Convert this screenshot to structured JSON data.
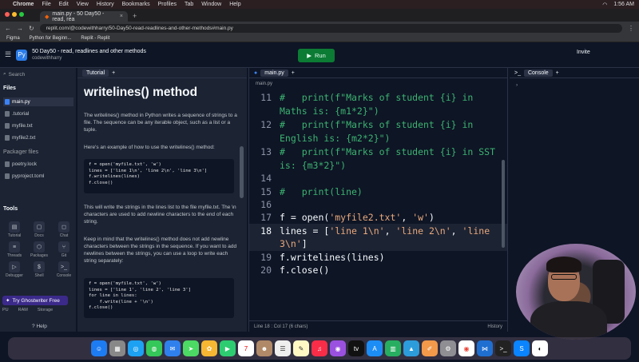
{
  "os_menu": {
    "apple": "",
    "app": "Chrome",
    "items": [
      "File",
      "Edit",
      "View",
      "History",
      "Bookmarks",
      "Profiles",
      "Tab",
      "Window",
      "Help"
    ],
    "clock": "1:56 AM"
  },
  "browser": {
    "tab_title": "main.py - 50 Day50 - read, rea",
    "url": "replit.com/@codewithharry/50-Day50-read-readlines-and-other-methods#main.py",
    "bookmarks": [
      "Figma",
      "Python for Beginn...",
      "Replit - Replit"
    ]
  },
  "repl": {
    "title": "50 Day50 - read, readlines and other methods",
    "owner": "codewithharry",
    "run_label": "Run",
    "invite_label": "Invite"
  },
  "sidebar": {
    "search_placeholder": "Search",
    "files_header": "Files",
    "files": [
      "main.py",
      ".tutorial",
      "myfile.txt",
      "myfile2.txt"
    ],
    "packager_header": "Packager files",
    "packager_files": [
      "poetry.lock",
      "pyproject.toml"
    ],
    "tools_header": "Tools",
    "tools": [
      "Tutorial",
      "Docs",
      "Chat",
      "Threads",
      "Packages",
      "Git",
      "Debugger",
      "Shell",
      "Console"
    ],
    "ghostwriter_label": "Try Ghostwriter Free",
    "usage": [
      "PU",
      "RAM",
      "Storage"
    ],
    "help_label": "Help"
  },
  "tutorial": {
    "tab_label": "Tutorial",
    "heading": "writelines() method",
    "p1": "The writelines() method in Python writes a sequence of strings to a file. The sequence can be any iterable object, such as a list or a tuple.",
    "p2": "Here's an example of how to use the writelines() method:",
    "code1": "f = open('myfile.txt', 'w')\nlines = ['line 1\\n', 'line 2\\n', 'line 3\\n']\nf.writelines(lines)\nf.close()",
    "p3": "This will write the strings in the lines list to the file myfile.txt. The \\n characters are used to add newline characters to the end of each string.",
    "p4": "Keep in mind that the writelines() method does not add newline characters between the strings in the sequence. If you want to add newlines between the strings, you can use a loop to write each string separately:",
    "code2": "f = open('myfile.txt', 'w')\nlines = ['line 1', 'line 2', 'line 3']\nfor line in lines:\n    f.write(line + '\\n')\nf.close()"
  },
  "editor": {
    "tab_label": "main.py",
    "breadcrumb": "main.py",
    "lines": [
      {
        "n": "11",
        "c1": "#   print(f\"Marks of student {i} in",
        "c2": "Maths is: {m1*2}\")"
      },
      {
        "n": "12",
        "c1": "#   print(f\"Marks of student {i} in",
        "c2": "English is: {m2*2}\")"
      },
      {
        "n": "13",
        "c1": "#   print(f\"Marks of student {i} in SST",
        "c2": "is: {m3*2}\")"
      },
      {
        "n": "14",
        "c1": ""
      },
      {
        "n": "15",
        "c1": "#   print(line)"
      },
      {
        "n": "16",
        "c1": ""
      },
      {
        "n": "17",
        "a": "f = open(",
        "s1": "'myfile2.txt'",
        "b": ", ",
        "s2": "'w'",
        "d": ")"
      },
      {
        "n": "18",
        "a": "lines = [",
        "s1": "'line 1\\n'",
        "b": ", ",
        "s2": "'line 2\\n'",
        "d": ", ",
        "s3": "'line",
        "e": "3\\n'",
        "f": "]"
      },
      {
        "n": "19",
        "c1": "f.writelines(lines)"
      },
      {
        "n": "20",
        "c1": "f.close()"
      }
    ],
    "status_pos": "Line 18 : Col 17 (6 chars)",
    "history_label": "History"
  },
  "console": {
    "tab_label": "Console",
    "prompt": "›"
  },
  "dock_apps": [
    "Finder",
    "Launchpad",
    "Safari",
    "Messages",
    "Mail",
    "Maps",
    "Photos",
    "FaceTime",
    "Calendar",
    "Contacts",
    "Reminders",
    "Notes",
    "Music",
    "Podcasts",
    "TV",
    "App Store",
    "Numbers",
    "Keynote",
    "Pages",
    "System Settings",
    "Chrome",
    "VS Code",
    "Terminal",
    "Shazam",
    "GitHub"
  ]
}
